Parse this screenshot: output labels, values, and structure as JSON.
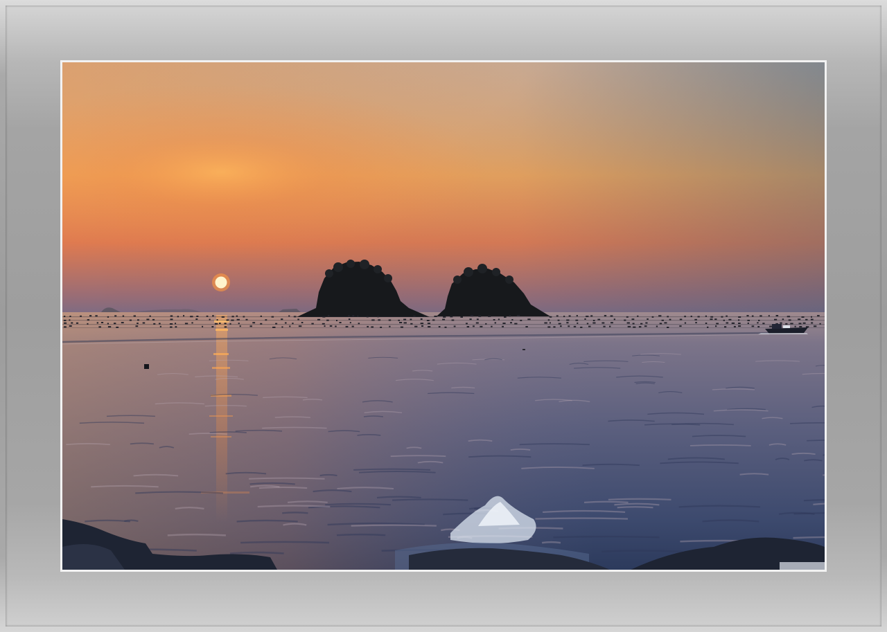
{
  "scene": {
    "description_colors": {
      "frame_gray": "#9e9e9e",
      "sky_top": "#8fa3b0",
      "sky_mid": "#f09a4a",
      "sky_horizon": "#c6624e",
      "sun": "#fff1c2",
      "sea": "#4b5777",
      "island": "#1a1c1e"
    },
    "elements": [
      "sun",
      "twin-islands",
      "distant-islands",
      "buoy-lines",
      "motorboat",
      "sun-reflection",
      "wave-splash",
      "foreground-rocks"
    ]
  }
}
